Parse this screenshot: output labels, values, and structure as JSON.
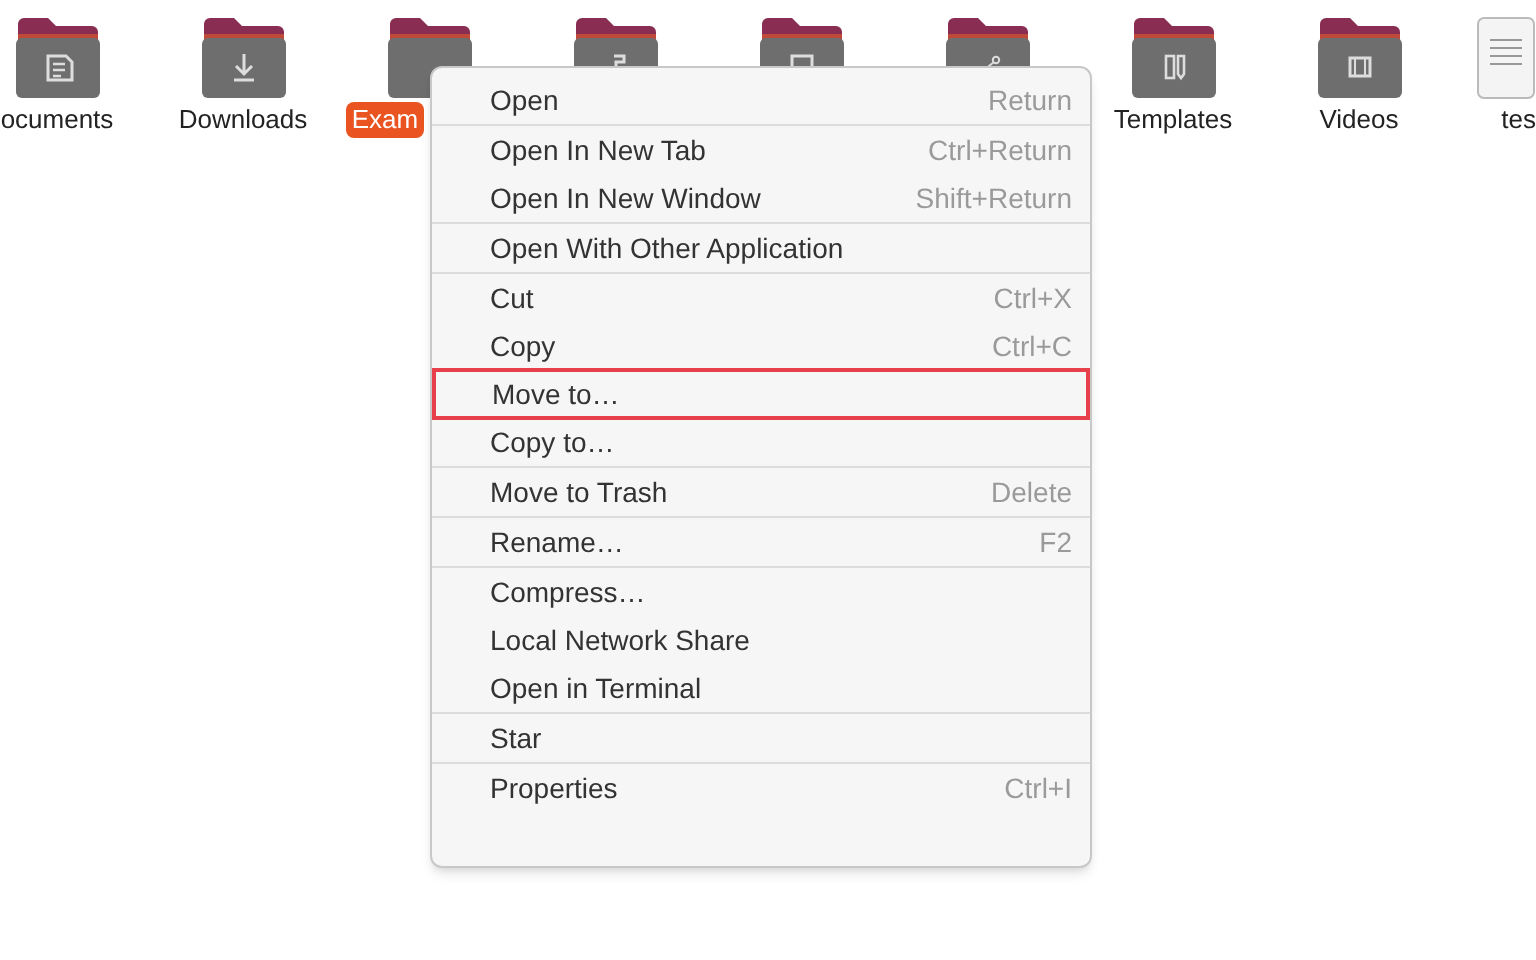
{
  "files": [
    {
      "kind": "documents",
      "label": "ocuments",
      "selected": false
    },
    {
      "kind": "downloads",
      "label": "Downloads",
      "selected": false
    },
    {
      "kind": "plain",
      "label": "Exam",
      "selected": true
    },
    {
      "kind": "music"
    },
    {
      "kind": "pictures"
    },
    {
      "kind": "public"
    },
    {
      "kind": "templates",
      "label": "Templates",
      "selected": false
    },
    {
      "kind": "videos",
      "label": "Videos",
      "selected": false
    },
    {
      "kind": "file",
      "label": "tes",
      "selected": false
    }
  ],
  "context_menu": {
    "groups": [
      [
        {
          "label": "Open",
          "shortcut": "Return",
          "outlined": false
        }
      ],
      [
        {
          "label": "Open In New Tab",
          "shortcut": "Ctrl+Return",
          "outlined": false
        },
        {
          "label": "Open In New Window",
          "shortcut": "Shift+Return",
          "outlined": false
        }
      ],
      [
        {
          "label": "Open With Other Application",
          "outlined": false
        }
      ],
      [
        {
          "label": "Cut",
          "shortcut": "Ctrl+X",
          "outlined": false
        },
        {
          "label": "Copy",
          "shortcut": "Ctrl+C",
          "outlined": false
        },
        {
          "label": "Move to…",
          "outlined": true
        },
        {
          "label": "Copy to…",
          "outlined": false
        }
      ],
      [
        {
          "label": "Move to Trash",
          "shortcut": "Delete",
          "outlined": false
        }
      ],
      [
        {
          "label": "Rename…",
          "shortcut": "F2",
          "outlined": false
        }
      ],
      [
        {
          "label": "Compress…",
          "outlined": false
        },
        {
          "label": "Local Network Share",
          "outlined": false
        },
        {
          "label": "Open in Terminal",
          "outlined": false
        }
      ],
      [
        {
          "label": "Star",
          "outlined": false
        }
      ],
      [
        {
          "label": "Properties",
          "shortcut": "Ctrl+I",
          "outlined": false
        }
      ]
    ]
  }
}
